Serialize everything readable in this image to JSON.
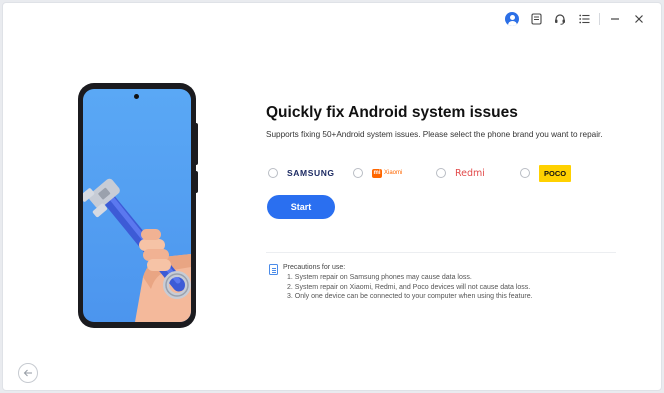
{
  "titlebar": {
    "icons": [
      "account-icon",
      "feedback-icon",
      "support-icon",
      "menu-icon",
      "minimize-icon",
      "close-icon"
    ]
  },
  "main": {
    "heading": "Quickly fix Android system issues",
    "description": "Supports fixing 50+Android system issues. Please select the phone brand you want to repair.",
    "brands": [
      {
        "name": "SAMSUNG",
        "logo": "samsung-logo"
      },
      {
        "name": "Xiaomi",
        "logo": "xiaomi-logo",
        "badge": "mi"
      },
      {
        "name": "Redmi",
        "logo": "redmi-logo"
      },
      {
        "name": "POCO",
        "logo": "poco-logo"
      }
    ],
    "start_label": "Start"
  },
  "precautions": {
    "title": "Precautions for use:",
    "items": [
      "1. System repair on Samsung phones may cause data loss.",
      "2. System repair on Xiaomi, Redmi, and Poco devices will not cause data loss.",
      "3. Only one device can be connected to your computer when using this feature."
    ]
  },
  "colors": {
    "accent": "#2a6ff0",
    "phone_screen": "#5aa8f5",
    "xiaomi_orange": "#ff6700",
    "poco_yellow": "#ffd100",
    "redmi_red": "#e24a4a"
  }
}
